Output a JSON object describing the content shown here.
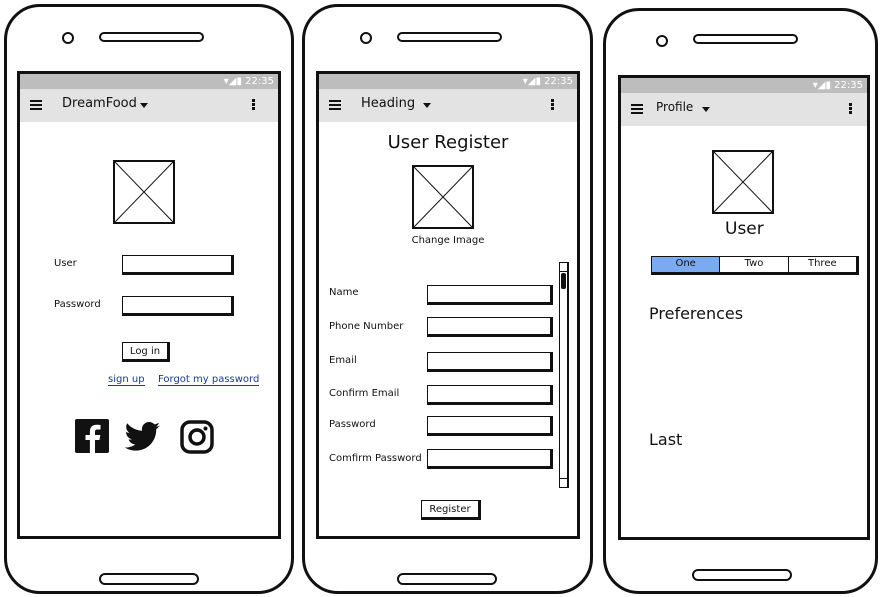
{
  "status_time": "22:35",
  "screens": {
    "login": {
      "app_title": "DreamFood",
      "user_label": "User",
      "password_label": "Password",
      "login_button": "Log in",
      "signup_link": "sign up",
      "forgot_link": "Forgot my password",
      "social_icons": [
        "facebook-icon",
        "twitter-icon",
        "instagram-icon"
      ]
    },
    "register": {
      "app_title": "Heading",
      "page_title": "User Register",
      "change_image": "Change Image",
      "fields": [
        {
          "label": "Name",
          "value": ""
        },
        {
          "label": "Phone Number",
          "value": ""
        },
        {
          "label": "Email",
          "value": ""
        },
        {
          "label": "Confirm Email",
          "value": ""
        },
        {
          "label": "Password",
          "value": ""
        },
        {
          "label": "Comfirm Password",
          "value": ""
        }
      ],
      "register_button": "Register"
    },
    "profile": {
      "app_title": "Profile",
      "user_name": "User",
      "tabs": [
        "One",
        "Two",
        "Three"
      ],
      "selected_tab": "One",
      "preferences_heading": "Preferences",
      "last_heading": "Last"
    }
  },
  "colors": {
    "appbar": "#e3e3e3",
    "statusbar": "#bdbdbd",
    "selected_tab": "#7aaaf0",
    "link": "#1a3a8c"
  }
}
